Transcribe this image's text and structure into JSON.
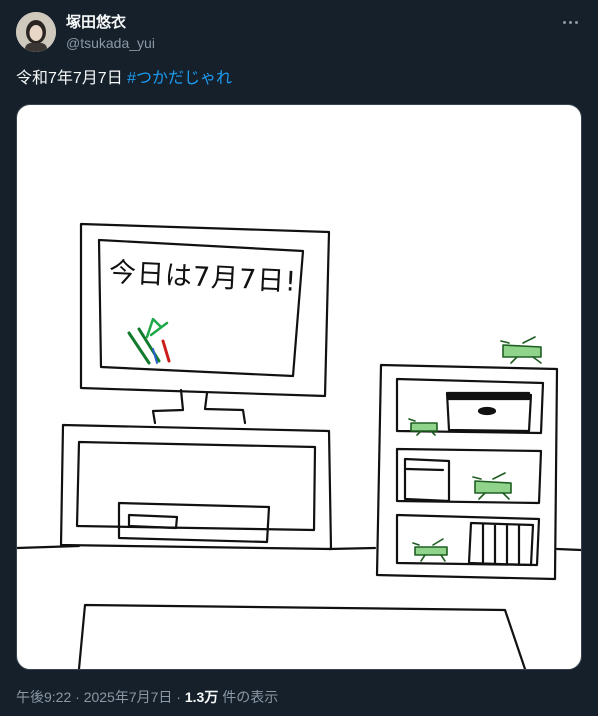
{
  "user": {
    "display_name": "塚田悠衣",
    "handle": "@tsukada_yui"
  },
  "tweet": {
    "text": "令和7年7月7日",
    "hashtag": "#つかだじゃれ"
  },
  "drawing": {
    "tv_caption": "今日は7月7日!"
  },
  "meta": {
    "time": "午後9:22",
    "sep1": " · ",
    "date": "2025年7月7日",
    "sep2": " · ",
    "views_count": "1.3万",
    "views_label": " 件の表示"
  },
  "icons": {
    "more": "more-dots-icon"
  },
  "colors": {
    "background": "#15202b",
    "hashtag": "#1d9bf0",
    "secondary_text": "#8b98a5"
  }
}
